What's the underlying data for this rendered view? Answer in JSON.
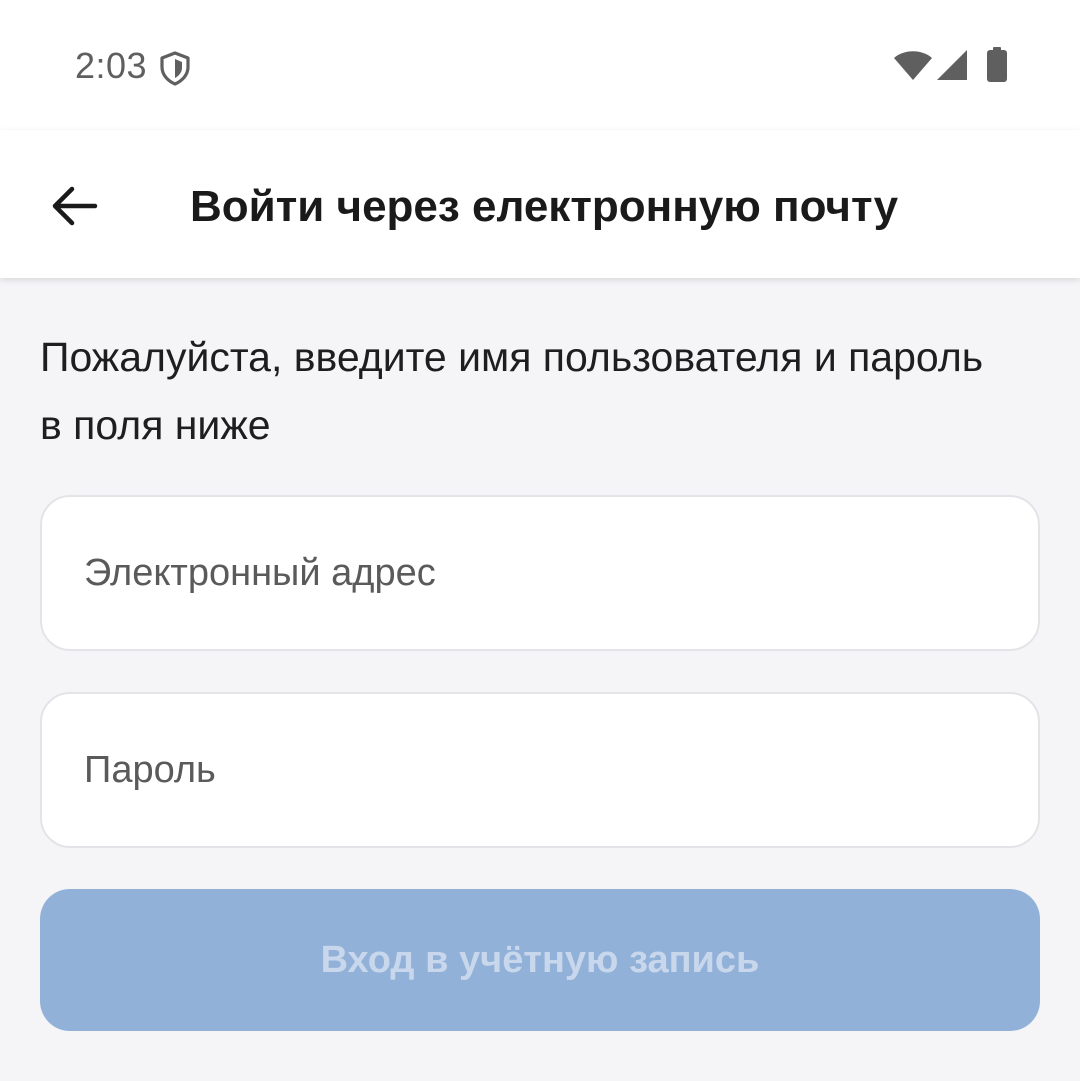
{
  "status_bar": {
    "time": "2:03",
    "icons": [
      "shield-icon",
      "wifi-icon",
      "cellular-signal-icon",
      "battery-icon"
    ]
  },
  "header": {
    "back_icon": "arrow-left-icon",
    "title": "Войти через електронную почту"
  },
  "main": {
    "instructions": "Пожалуйста, введите имя пользователя и пароль в поля ниже",
    "email": {
      "value": "",
      "placeholder": "Электронный адрес"
    },
    "password": {
      "value": "",
      "placeholder": "Пароль"
    },
    "login_button": {
      "label": "Вход в учётную запись",
      "enabled": false
    }
  },
  "colors": {
    "background": "#f5f5f8",
    "surface": "#ffffff",
    "button_disabled_bg": "#92b1d8",
    "button_disabled_text": "#c8d7ec",
    "text_primary": "#1a1a1a"
  }
}
